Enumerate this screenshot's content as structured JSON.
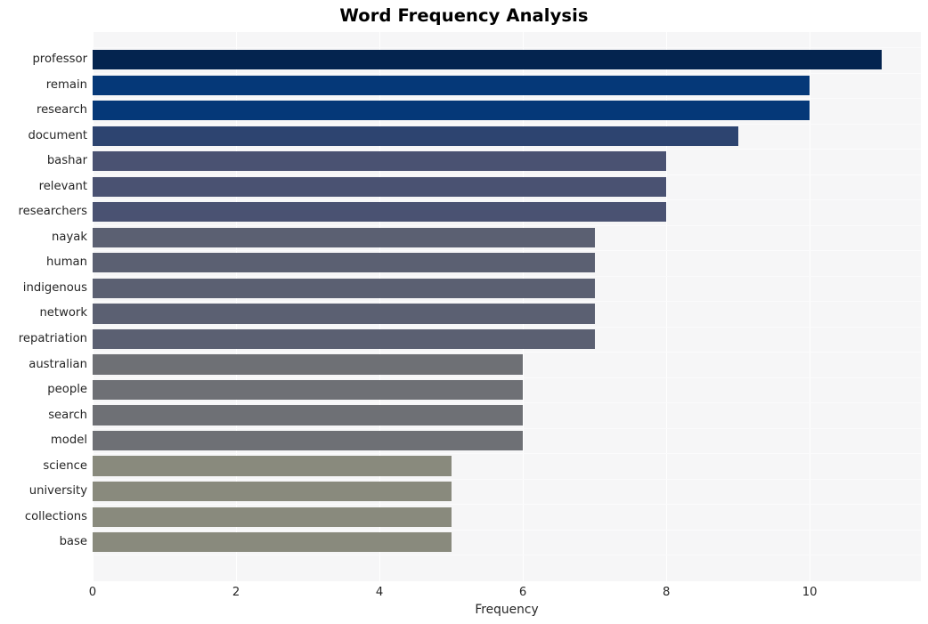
{
  "chart_data": {
    "type": "bar",
    "orientation": "horizontal",
    "title": "Word Frequency Analysis",
    "xlabel": "Frequency",
    "ylabel": "",
    "xlim": [
      0,
      11.55
    ],
    "xticks": [
      0,
      2,
      4,
      6,
      8,
      10
    ],
    "xtick_labels": [
      "0",
      "2",
      "4",
      "6",
      "8",
      "10"
    ],
    "grid": true,
    "grid_color": "#ffffff",
    "plot_background": "#f6f6f7",
    "legend": null,
    "categories": [
      "professor",
      "remain",
      "research",
      "document",
      "bashar",
      "relevant",
      "researchers",
      "nayak",
      "human",
      "indigenous",
      "network",
      "repatriation",
      "australian",
      "people",
      "search",
      "model",
      "science",
      "university",
      "collections",
      "base"
    ],
    "values": [
      11,
      10,
      10,
      9,
      8,
      8,
      8,
      7,
      7,
      7,
      7,
      7,
      6,
      6,
      6,
      6,
      5,
      5,
      5,
      5
    ],
    "bar_colors": [
      "#04244f",
      "#053878",
      "#053878",
      "#2d4470",
      "#4a5272",
      "#4a5272",
      "#4a5272",
      "#5b6072",
      "#5b6072",
      "#5b6072",
      "#5b6072",
      "#5b6072",
      "#6e7075",
      "#6e7075",
      "#6e7075",
      "#6e7075",
      "#898a7d",
      "#898a7d",
      "#898a7d",
      "#898a7d"
    ]
  }
}
